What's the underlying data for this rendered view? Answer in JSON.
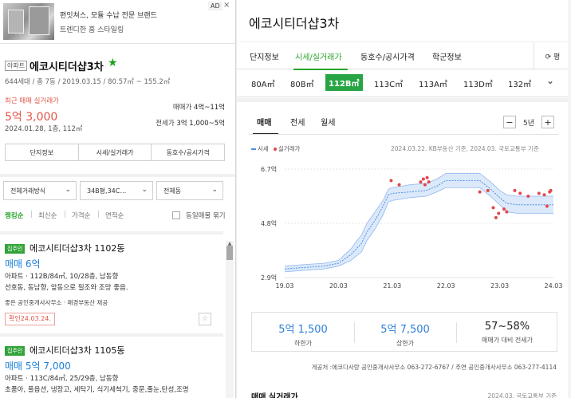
{
  "ad": {
    "title": "편잇쳐스, 모듈 수납 전문 브랜드",
    "subtitle": "트렌디한 홈 스타일링",
    "badge": "AD",
    "close": "×"
  },
  "summary": {
    "type_badge": "아파트",
    "name": "에코시티더샵3차",
    "star": "★",
    "meta": "644세대 / 총 7동 / 2019.03.15 / 80.57㎡ ~ 155.2㎡",
    "recent_label": "최근 매매 실거래가",
    "recent_price": "5억 3,000",
    "recent_date": "2024.01.28, 1층, 112㎡",
    "sale_label": "매매가",
    "sale_range": "4억~11억",
    "jeonse_label": "전세가",
    "jeonse_range": "3억 1,000~5억"
  },
  "buttons": [
    "단지정보",
    "시세/실거래가",
    "동호수/공시가격"
  ],
  "filters": {
    "trade": "전체거래방식",
    "area": "34B평,34C…",
    "building": "전체동"
  },
  "sort": {
    "items": [
      "랭킹순",
      "최신순",
      "가격순",
      "면적순"
    ],
    "same_listing": "동일매물 묶기"
  },
  "listings": [
    {
      "badge": "집주인",
      "title": "에코시티더샵3차 1102동",
      "price": "매매 6억",
      "info1": "아파트 · 112B/84㎡, 10/28층, 남동향",
      "info2": "선호동, 동남향, 앞동으로 필조와 조망 좋음.",
      "agent": "좋은 공인중개사사무소 · 매경부동산 제공",
      "confirm": "확인24.03.24."
    },
    {
      "badge": "집주인",
      "title": "에코시티더샵3차 1105동",
      "price": "매매 5억 7,000",
      "info1": "아파트 · 113C/84㎡, 25/29층, 남동향",
      "info2": "초품아, 풀옵션, 냉장고, 세탁기, 식기세척기, 중문,줄눈,탄성,조명"
    }
  ],
  "right": {
    "title": "에코시티더샵3차",
    "tabs": [
      "단지정보",
      "시세/실거래가",
      "동호수/공시가격",
      "학군정보"
    ],
    "refresh_label": "⟳ 평",
    "areas": [
      "80A㎡",
      "80B㎡",
      "112B㎡",
      "113C㎡",
      "113A㎡",
      "113D㎡",
      "132㎡"
    ],
    "area_chevron": "⌄",
    "subtabs": [
      "매매",
      "전세",
      "월세"
    ],
    "period": "5년",
    "minus": "−",
    "plus": "+",
    "legend_price": "시세",
    "legend_trade": "실거래가",
    "source": "2024.03.22. KB부동산 기준, 2024.03. 국토교통부 기준",
    "stats": [
      {
        "value": "5억 1,500",
        "label": "하한가"
      },
      {
        "value": "5억 7,500",
        "label": "상한가"
      },
      {
        "value": "57~58%",
        "label": "매매가 대비 전세가"
      }
    ],
    "contact": "게공처 :에코다사랑 공인중개사사무소 063-272-6767 / 주연 공인중개사사무소 063-277-4114",
    "bottom_title": "매매 실거래가",
    "bottom_src": "2024.03. 국토교통부 기준"
  },
  "chart_data": {
    "type": "line",
    "x_ticks": [
      "19.03",
      "20.03",
      "21.03",
      "22.03",
      "23.03",
      "24.03"
    ],
    "y_ticks": [
      "6.7억",
      "4.8억",
      "2.9억"
    ],
    "ylim": [
      2.9,
      6.7
    ],
    "xlim": [
      2019.17,
      2024.17
    ],
    "series": [
      {
        "name": "시세",
        "x": [
          2019.17,
          2019.5,
          2019.9,
          2020.17,
          2020.4,
          2020.6,
          2020.7,
          2020.85,
          2021.0,
          2021.1,
          2021.17,
          2021.5,
          2021.8,
          2022.0,
          2022.17,
          2022.5,
          2022.8,
          2023.0,
          2023.17,
          2023.3,
          2023.5,
          2023.8,
          2024.17
        ],
        "y": [
          3.2,
          3.25,
          3.3,
          3.4,
          3.7,
          4.1,
          4.5,
          4.9,
          5.4,
          5.8,
          5.85,
          5.9,
          5.95,
          6.1,
          6.3,
          6.3,
          6.3,
          6.0,
          5.7,
          5.5,
          5.45,
          5.45,
          5.45
        ],
        "upper": [
          3.3,
          3.35,
          3.4,
          3.5,
          3.9,
          4.4,
          4.8,
          5.2,
          5.6,
          6.0,
          6.05,
          6.15,
          6.2,
          6.35,
          6.55,
          6.55,
          6.55,
          6.25,
          5.95,
          5.8,
          5.75,
          5.75,
          5.75
        ],
        "lower": [
          3.1,
          3.15,
          3.2,
          3.3,
          3.5,
          3.8,
          4.2,
          4.6,
          5.1,
          5.55,
          5.6,
          5.7,
          5.75,
          5.9,
          6.05,
          6.05,
          6.05,
          5.75,
          5.45,
          5.2,
          5.15,
          5.15,
          5.15
        ]
      },
      {
        "name": "실거래가",
        "points": [
          [
            2021.15,
            6.3
          ],
          [
            2021.3,
            6.15
          ],
          [
            2021.7,
            6.25
          ],
          [
            2021.75,
            6.35
          ],
          [
            2021.78,
            6.15
          ],
          [
            2021.82,
            6.4
          ],
          [
            2021.85,
            6.25
          ],
          [
            2022.8,
            5.9
          ],
          [
            2022.95,
            5.95
          ],
          [
            2023.05,
            5.35
          ],
          [
            2023.1,
            5.0
          ],
          [
            2023.15,
            5.15
          ],
          [
            2023.25,
            5.3
          ],
          [
            2023.3,
            5.2
          ],
          [
            2023.45,
            5.95
          ],
          [
            2023.55,
            5.85
          ],
          [
            2023.7,
            5.75
          ],
          [
            2023.9,
            5.85
          ],
          [
            2024.0,
            5.8
          ],
          [
            2024.05,
            5.4
          ],
          [
            2024.1,
            5.9
          ],
          [
            2024.12,
            5.95
          ]
        ]
      }
    ]
  }
}
